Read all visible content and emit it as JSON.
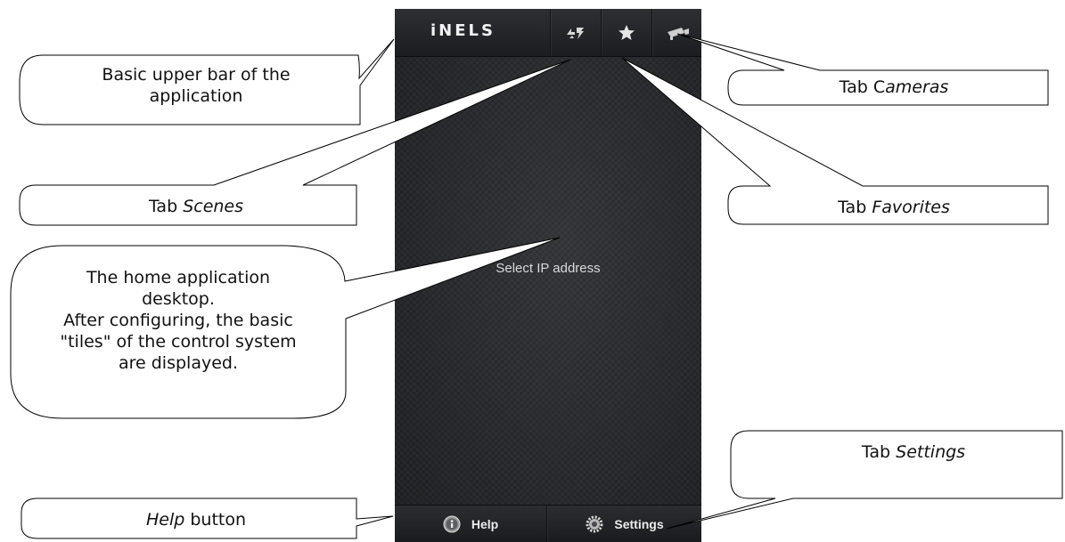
{
  "app": {
    "logo_text": "iNELS",
    "tabs": [
      {
        "name": "Scenes",
        "icon": "scenes-icon"
      },
      {
        "name": "Favorites",
        "icon": "star-icon"
      },
      {
        "name": "Cameras",
        "icon": "camera-icon"
      }
    ],
    "center_text": "Select IP address",
    "bottom": {
      "help_label": "Help",
      "help_icon": "info-icon",
      "settings_label": "Settings",
      "settings_icon": "gear-icon"
    }
  },
  "callouts": {
    "upper_bar": {
      "line1": "Basic upper bar of the",
      "line2": "application"
    },
    "scenes": {
      "prefix": "Tab ",
      "emph": "Scenes"
    },
    "cameras": {
      "prefix": "Tab C",
      "emph": "ameras"
    },
    "favorites": {
      "prefix": "Tab ",
      "emph": "Favorites"
    },
    "desktop": {
      "line1": "The home application",
      "line2": "desktop.",
      "line3": "After configuring, the basic",
      "line4": "\"tiles\" of the control system",
      "line5": "are displayed."
    },
    "settings": {
      "prefix": "Tab ",
      "emph": "Settings"
    },
    "help": {
      "emph": "Help",
      "suffix": " button"
    }
  },
  "colors": {
    "background": "#ffffff",
    "phone_bg": "#2a2b2e",
    "bar_bg": "#1c1d20",
    "text_light": "#ececec"
  }
}
